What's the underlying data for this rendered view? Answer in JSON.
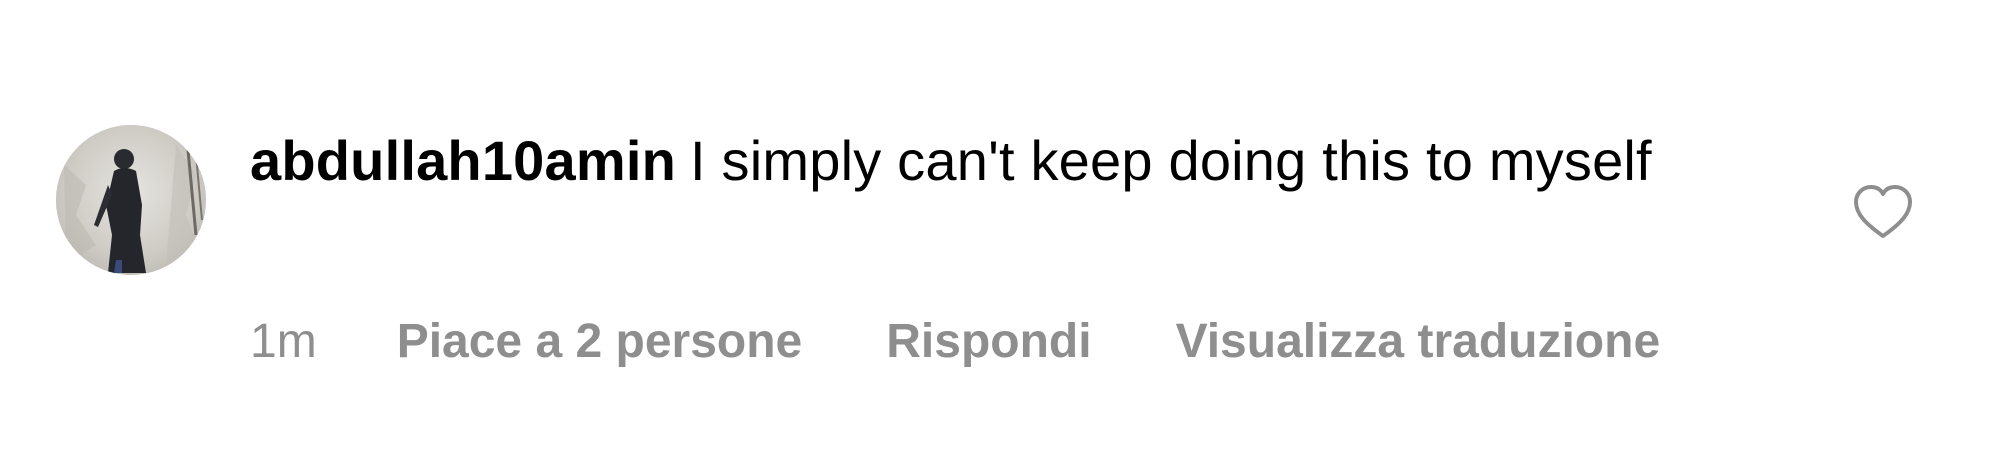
{
  "comment": {
    "username": "abdullah10amin",
    "text": "I simply can't keep doing this to myself",
    "avatar_icon": "profile-photo-silhouette",
    "like_icon": "heart-outline-icon",
    "time": "1m",
    "likes_label": "Piace a 2 persone",
    "reply_label": "Rispondi",
    "translate_label": "Visualizza traduzione"
  },
  "colors": {
    "text": "#000000",
    "meta": "#8e8e8e",
    "icon": "#8e8e8e",
    "background": "#ffffff"
  }
}
